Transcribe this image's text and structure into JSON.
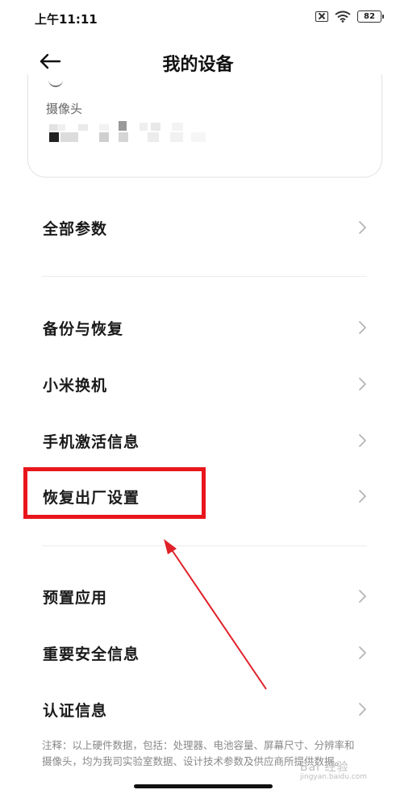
{
  "status_bar": {
    "time": "上午11:11",
    "battery_level": "82",
    "icons": [
      "sim-off-icon",
      "wifi-icon",
      "battery-icon"
    ]
  },
  "header": {
    "title": "我的设备",
    "back_icon": "arrow-left-icon"
  },
  "camera_card": {
    "label": "摄像头"
  },
  "menu": {
    "group1": [
      {
        "label": "全部参数"
      }
    ],
    "group2": [
      {
        "label": "备份与恢复"
      },
      {
        "label": "小米换机"
      },
      {
        "label": "手机激活信息"
      },
      {
        "label": "恢复出厂设置"
      }
    ],
    "group3": [
      {
        "label": "预置应用"
      },
      {
        "label": "重要安全信息"
      },
      {
        "label": "认证信息"
      }
    ]
  },
  "footnote": {
    "line1": "注释：以上硬件数据，包括：处理器、电池容量、屏幕尺寸、分辨率和",
    "line2": "摄像头，均为我司实验室数据、设计技术参数及供应商所提供数据。"
  },
  "watermark": {
    "main": "Bai 经验",
    "sub": "jingyan.baidu.com"
  },
  "colors": {
    "highlight": "#e8161b",
    "text_primary": "#1a1a1a",
    "text_secondary": "#888888",
    "chevron": "#b5b5b5"
  }
}
